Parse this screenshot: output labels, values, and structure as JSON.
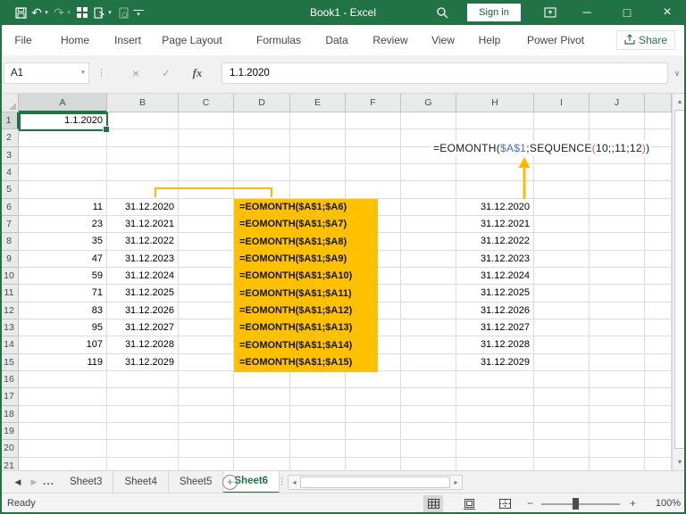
{
  "titlebar": {
    "title": "Book1 - Excel",
    "sign_in": "Sign in"
  },
  "ribbon": {
    "tabs": [
      "File",
      "Home",
      "Insert",
      "Page Layout",
      "Formulas",
      "Data",
      "Review",
      "View",
      "Help",
      "Power Pivot"
    ],
    "share": "Share"
  },
  "formula_bar": {
    "name_box": "A1",
    "value": "1.1.2020"
  },
  "sheet": {
    "columns": [
      "A",
      "B",
      "C",
      "D",
      "E",
      "F",
      "G",
      "H",
      "I",
      "J"
    ],
    "row_count": 21,
    "a1": "1.1.2020",
    "data_rows": [
      {
        "row": 6,
        "months": "11",
        "date": "31.12.2020",
        "formula": "=EOMONTH($A$1;$A6)",
        "result": "31.12.2020"
      },
      {
        "row": 7,
        "months": "23",
        "date": "31.12.2021",
        "formula": "=EOMONTH($A$1;$A7)",
        "result": "31.12.2021"
      },
      {
        "row": 8,
        "months": "35",
        "date": "31.12.2022",
        "formula": "=EOMONTH($A$1;$A8)",
        "result": "31.12.2022"
      },
      {
        "row": 9,
        "months": "47",
        "date": "31.12.2023",
        "formula": "=EOMONTH($A$1;$A9)",
        "result": "31.12.2023"
      },
      {
        "row": 10,
        "months": "59",
        "date": "31.12.2024",
        "formula": "=EOMONTH($A$1;$A10)",
        "result": "31.12.2024"
      },
      {
        "row": 11,
        "months": "71",
        "date": "31.12.2025",
        "formula": "=EOMONTH($A$1;$A11)",
        "result": "31.12.2025"
      },
      {
        "row": 12,
        "months": "83",
        "date": "31.12.2026",
        "formula": "=EOMONTH($A$1;$A12)",
        "result": "31.12.2026"
      },
      {
        "row": 13,
        "months": "95",
        "date": "31.12.2027",
        "formula": "=EOMONTH($A$1;$A13)",
        "result": "31.12.2027"
      },
      {
        "row": 14,
        "months": "107",
        "date": "31.12.2028",
        "formula": "=EOMONTH($A$1;$A14)",
        "result": "31.12.2028"
      },
      {
        "row": 15,
        "months": "119",
        "date": "31.12.2029",
        "formula": "=EOMONTH($A$1;$A15)",
        "result": "31.12.2029"
      }
    ],
    "annotation_formula": [
      {
        "text": "=EOMONTH(",
        "color": "#1A1A1A"
      },
      {
        "text": "$A$1",
        "color": "#4472C4"
      },
      {
        "text": ";SEQUENCE",
        "color": "#1A1A1A"
      },
      {
        "text": "(",
        "color": "#E05252"
      },
      {
        "text": "10;;11;12",
        "color": "#1A1A1A"
      },
      {
        "text": ")",
        "color": "#E05252"
      },
      {
        "text": ")",
        "color": "#1A1A1A"
      }
    ]
  },
  "sheet_tabs": {
    "sheets": [
      {
        "label": "Sheet3",
        "active": false
      },
      {
        "label": "Sheet4",
        "active": false
      },
      {
        "label": "Sheet5",
        "active": false
      },
      {
        "label": "Sheet6",
        "active": true
      }
    ]
  },
  "status_bar": {
    "ready": "Ready",
    "zoom_level": "100%"
  },
  "icons": {
    "undo": "↶",
    "redo": "↷",
    "caret_down": "▾",
    "minimize": "─",
    "maximize": "□",
    "close": "×",
    "cancel": "×",
    "enter": "✓",
    "fx": "fx",
    "chevron_down": "∨",
    "up": "▴",
    "down": "▾",
    "left": "◂",
    "right": "▸",
    "tab_prev": "◀",
    "tab_next": "▶",
    "overflow_dots": "...",
    "new_sheet": "+",
    "minus": "−",
    "plus": "+",
    "vertical_dots": "⋮"
  },
  "colors": {
    "excel_green": "#217346",
    "highlight_yellow": "#FFC000",
    "annotation_gold": "#FFB900"
  }
}
